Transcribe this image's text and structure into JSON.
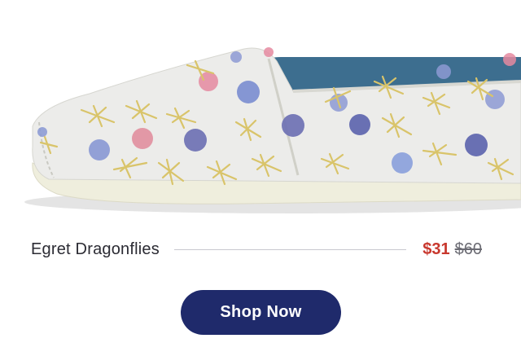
{
  "product": {
    "name": "Egret Dragonflies",
    "sale_price": "$31",
    "original_price": "$60"
  },
  "cta": {
    "label": "Shop Now"
  },
  "colors": {
    "button_bg": "#1f2a6b",
    "sale_price": "#c8372d",
    "canvas": "#ececec",
    "sole": "#efeedd",
    "lining": "#3d6e8f"
  }
}
